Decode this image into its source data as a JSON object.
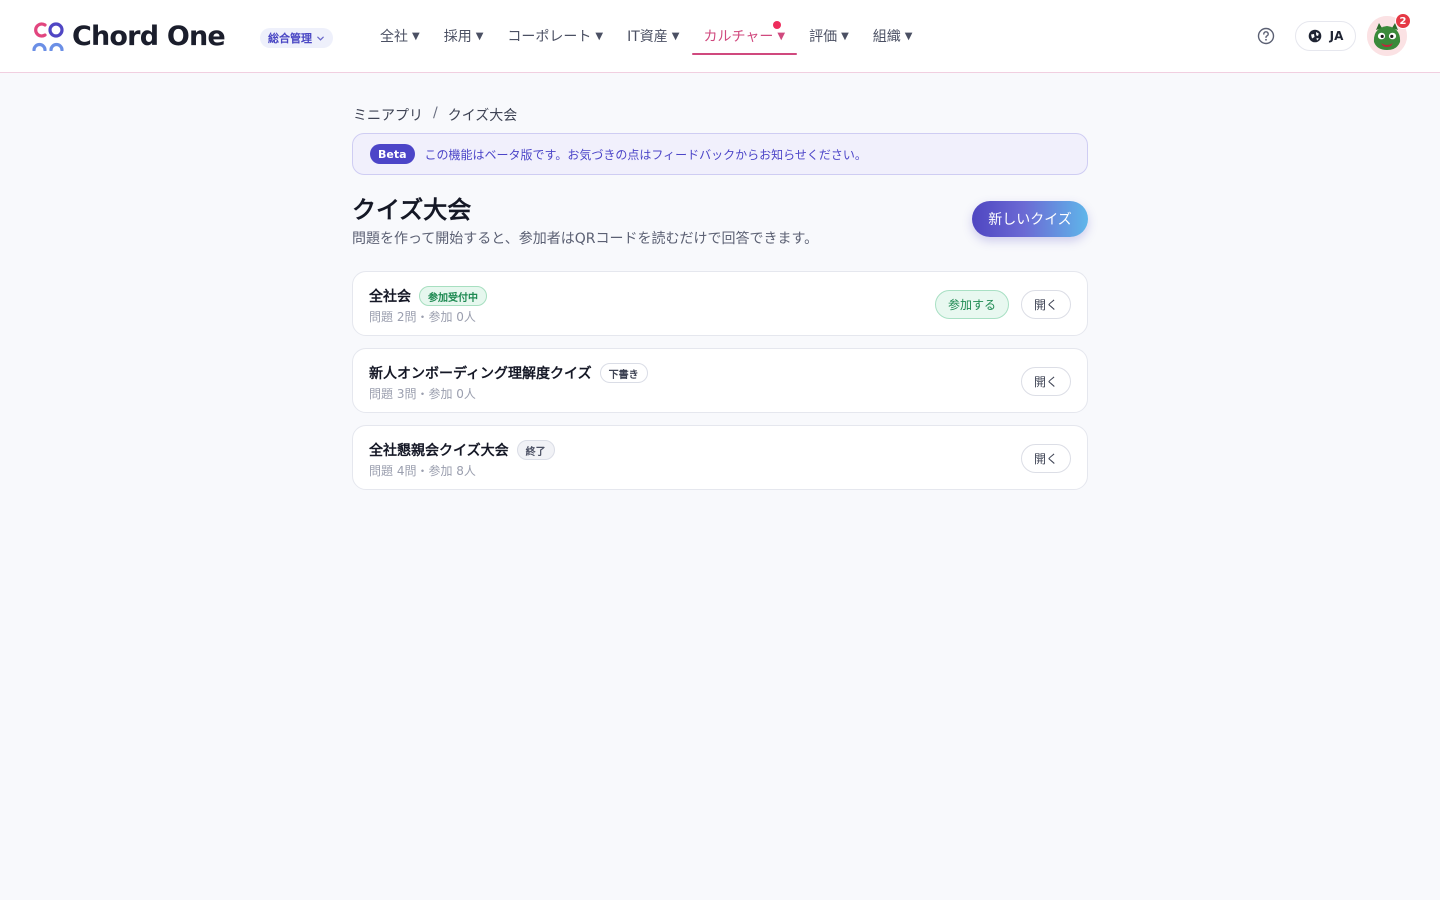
{
  "header": {
    "brand": "Chord One",
    "scope_label": "総合管理",
    "nav": [
      {
        "label": "全社",
        "caret": "▼"
      },
      {
        "label": "採用",
        "caret": "▼"
      },
      {
        "label": "コーポレート",
        "caret": "▼"
      },
      {
        "label": "IT資産",
        "caret": "▼"
      },
      {
        "label": "カルチャー",
        "caret": "▼",
        "active": true
      },
      {
        "label": "評価",
        "caret": "▼"
      },
      {
        "label": "組織",
        "caret": "▼"
      }
    ],
    "language": "JA",
    "notification_count": "2"
  },
  "breadcrumb": {
    "parent": "ミニアプリ",
    "separator": "/",
    "current": "クイズ大会"
  },
  "beta": {
    "tag": "Beta",
    "message": "この機能はベータ版です。お気づきの点はフィードバックからお知らせください。"
  },
  "page": {
    "title": "クイズ大会",
    "subtitle": "問題を作って開始すると、参加者はQRコードを読むだけで回答できます。",
    "new_button": "新しいクイズ"
  },
  "quizzes": [
    {
      "name": "全社会",
      "status": "参加受付中",
      "meta": "問題 2問・参加 0人",
      "join_label": "参加する",
      "open_label": "開く"
    },
    {
      "name": "新人オンボーディング理解度クイズ",
      "status": "下書き",
      "meta": "問題 3問・参加 0人",
      "open_label": "開く"
    },
    {
      "name": "全社懇親会クイズ大会",
      "status": "終了",
      "meta": "問題 4問・参加 8人",
      "open_label": "開く"
    }
  ],
  "colors": {
    "accent": "#4c45c8",
    "active_nav": "#d0497e",
    "status_open": "#1e8a52",
    "notification": "#e53945"
  }
}
